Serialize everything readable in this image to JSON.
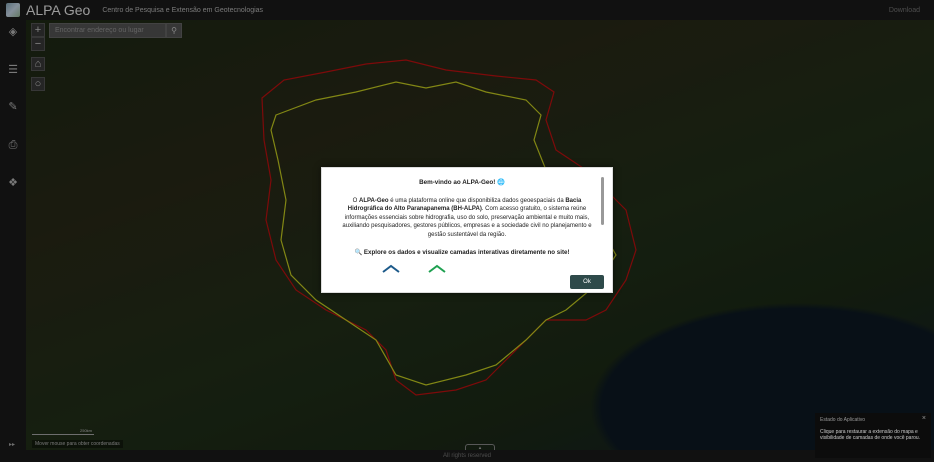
{
  "header": {
    "title": "ALPA Geo",
    "subtitle": "Centro de Pesquisa e Extensão em Geotecnologias",
    "download": "Download"
  },
  "search": {
    "placeholder": "Encontrar endereço ou lugar"
  },
  "map": {
    "zoom_in": "+",
    "zoom_out": "−",
    "coordinates_hint": "Mover mouse para obter coordenadas",
    "scale": "250km",
    "basin_outline_color": "#d9e021",
    "region_outline_color": "#d01010"
  },
  "modal": {
    "title": "Bem-vindo ao ALPA-Geo! 🌐",
    "body_prefix": "O ",
    "body_bold1": "ALPA-Geo",
    "body_mid": " é uma plataforma online que disponibiliza dados geoespaciais da ",
    "body_bold2": "Bacia Hidrográfica do Alto Paranapanema (BH-ALPA)",
    "body_suffix": ". Com acesso gratuito, o sistema reúne informações essenciais sobre hidrografia, uso do solo, preservação ambiental e muito mais, auxiliando pesquisadores, gestores públicos, empresas e a sociedade civil no planejamento e gestão sustentável da região.",
    "explore": "🔍 Explore os dados e visualize camadas interativas diretamente no site!",
    "ok": "Ok"
  },
  "toast": {
    "title": "Estado do Aplicativo",
    "body": "Clique para restaurar a extensão do mapa e visibilidade de camadas de onde você parou.",
    "close": "×"
  },
  "footer": {
    "text": "All rights reserved"
  }
}
